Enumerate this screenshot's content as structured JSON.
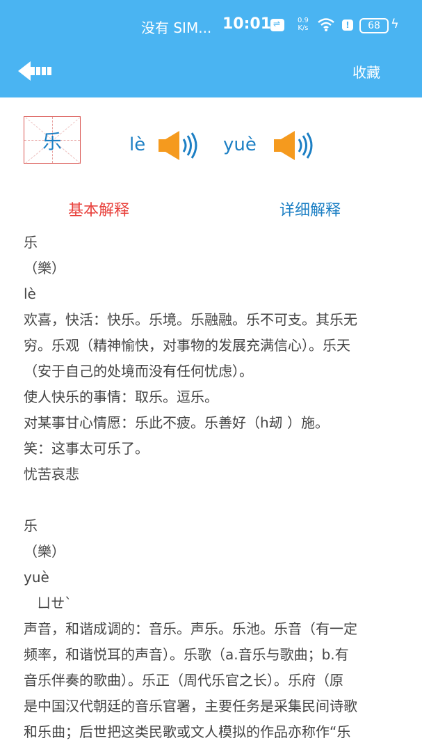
{
  "status_bar": {
    "carrier": "没有 SIM...",
    "time": "10:01",
    "speed_value": "0.9",
    "speed_unit": "K/s",
    "battery": "68"
  },
  "header": {
    "back_icon": "back-arrow-icon",
    "favorite_label": "收藏",
    "bar_color": "#4ab4f2"
  },
  "character": {
    "glyph": "乐",
    "readings": [
      {
        "pinyin": "lè"
      },
      {
        "pinyin": "yuè"
      }
    ]
  },
  "tabs": {
    "basic_label": "基本解释",
    "detail_label": "详细解释",
    "active_color": "#e8413c",
    "inactive_color": "#1c7fc4"
  },
  "definition_lines": [
    "乐",
    "（樂）",
    "lè",
    "欢喜，快活：快乐。乐境。乐融融。乐不可支。其乐无",
    "穷。乐观（精神愉快，对事物的发展充满信心）。乐天",
    "（安于自己的处境而没有任何忧虑）。",
    "使人快乐的事情：取乐。逗乐。",
    "对某事甘心情愿：乐此不疲。乐善好（h刼 ）施。",
    "笑：这事太可乐了。",
    "忧苦哀悲",
    "",
    "乐",
    "（樂）",
    "yuè",
    "   ㄩㄝˋ",
    "声音，和谐成调的：音乐。声乐。乐池。乐音（有一定",
    "频率，和谐悦耳的声音）。乐歌（a.音乐与歌曲；b.有",
    "音乐伴奏的歌曲）。乐正（周代乐官之长）。乐府（原",
    "是中国汉代朝廷的音乐官署，主要任务是采集民间诗歌",
    "和乐曲；后世把这类民歌或文人模拟的作品亦称作“乐"
  ]
}
